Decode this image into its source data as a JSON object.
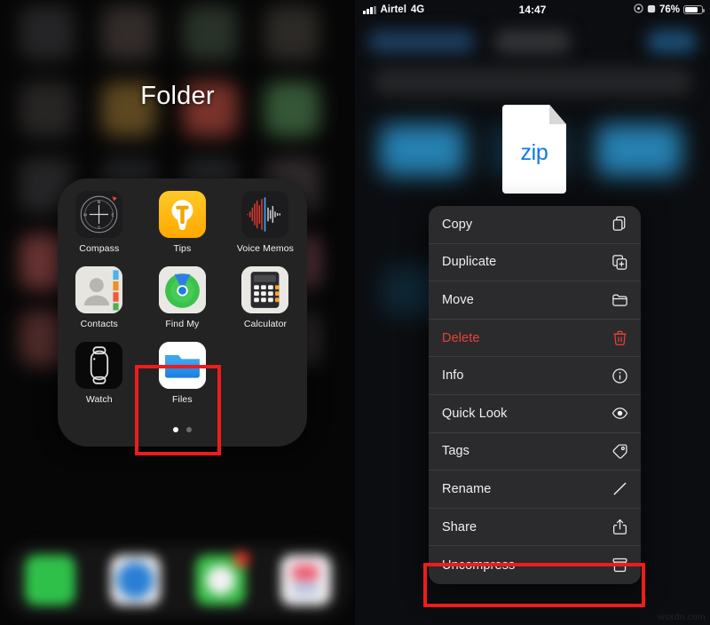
{
  "left_panel": {
    "folder_title": "Folder",
    "apps": [
      {
        "label": "Compass",
        "icon": "compass-icon"
      },
      {
        "label": "Tips",
        "icon": "tips-lightbulb-icon"
      },
      {
        "label": "Voice Memos",
        "icon": "voice-memos-icon"
      },
      {
        "label": "Contacts",
        "icon": "contacts-icon"
      },
      {
        "label": "Find My",
        "icon": "find-my-icon"
      },
      {
        "label": "Calculator",
        "icon": "calculator-icon"
      },
      {
        "label": "Watch",
        "icon": "watch-icon"
      },
      {
        "label": "Files",
        "icon": "files-folder-icon"
      }
    ],
    "page_dots": {
      "count": 2,
      "active_index": 0
    },
    "highlight": {
      "target": "Files",
      "color": "#ee1c1c"
    }
  },
  "right_panel": {
    "status_bar": {
      "carrier": "Airtel",
      "network": "4G",
      "time": "14:47",
      "battery_percent": "76%",
      "signal_bars": 4
    },
    "file": {
      "type_label": "zip",
      "icon": "zip-document-icon",
      "label_color": "#1178f0"
    },
    "context_menu": {
      "items": [
        {
          "label": "Copy",
          "icon": "copy-icon",
          "danger": false
        },
        {
          "label": "Duplicate",
          "icon": "duplicate-icon",
          "danger": false
        },
        {
          "label": "Move",
          "icon": "folder-icon",
          "danger": false
        },
        {
          "label": "Delete",
          "icon": "trash-icon",
          "danger": true
        },
        {
          "label": "Info",
          "icon": "info-icon",
          "danger": false
        },
        {
          "label": "Quick Look",
          "icon": "eye-icon",
          "danger": false
        },
        {
          "label": "Tags",
          "icon": "tag-icon",
          "danger": false
        },
        {
          "label": "Rename",
          "icon": "pencil-icon",
          "danger": false
        },
        {
          "label": "Share",
          "icon": "share-icon",
          "danger": false
        },
        {
          "label": "Uncompress",
          "icon": "archive-box-icon",
          "danger": false
        }
      ]
    },
    "highlight": {
      "target": "Uncompress",
      "color": "#ee1c1c"
    }
  },
  "watermark": "wsxdn.com",
  "colors": {
    "danger": "#e8403a",
    "highlight": "#ee1c1c",
    "menu_bg": "#2b2b2d",
    "accent_blue": "#1178f0"
  }
}
